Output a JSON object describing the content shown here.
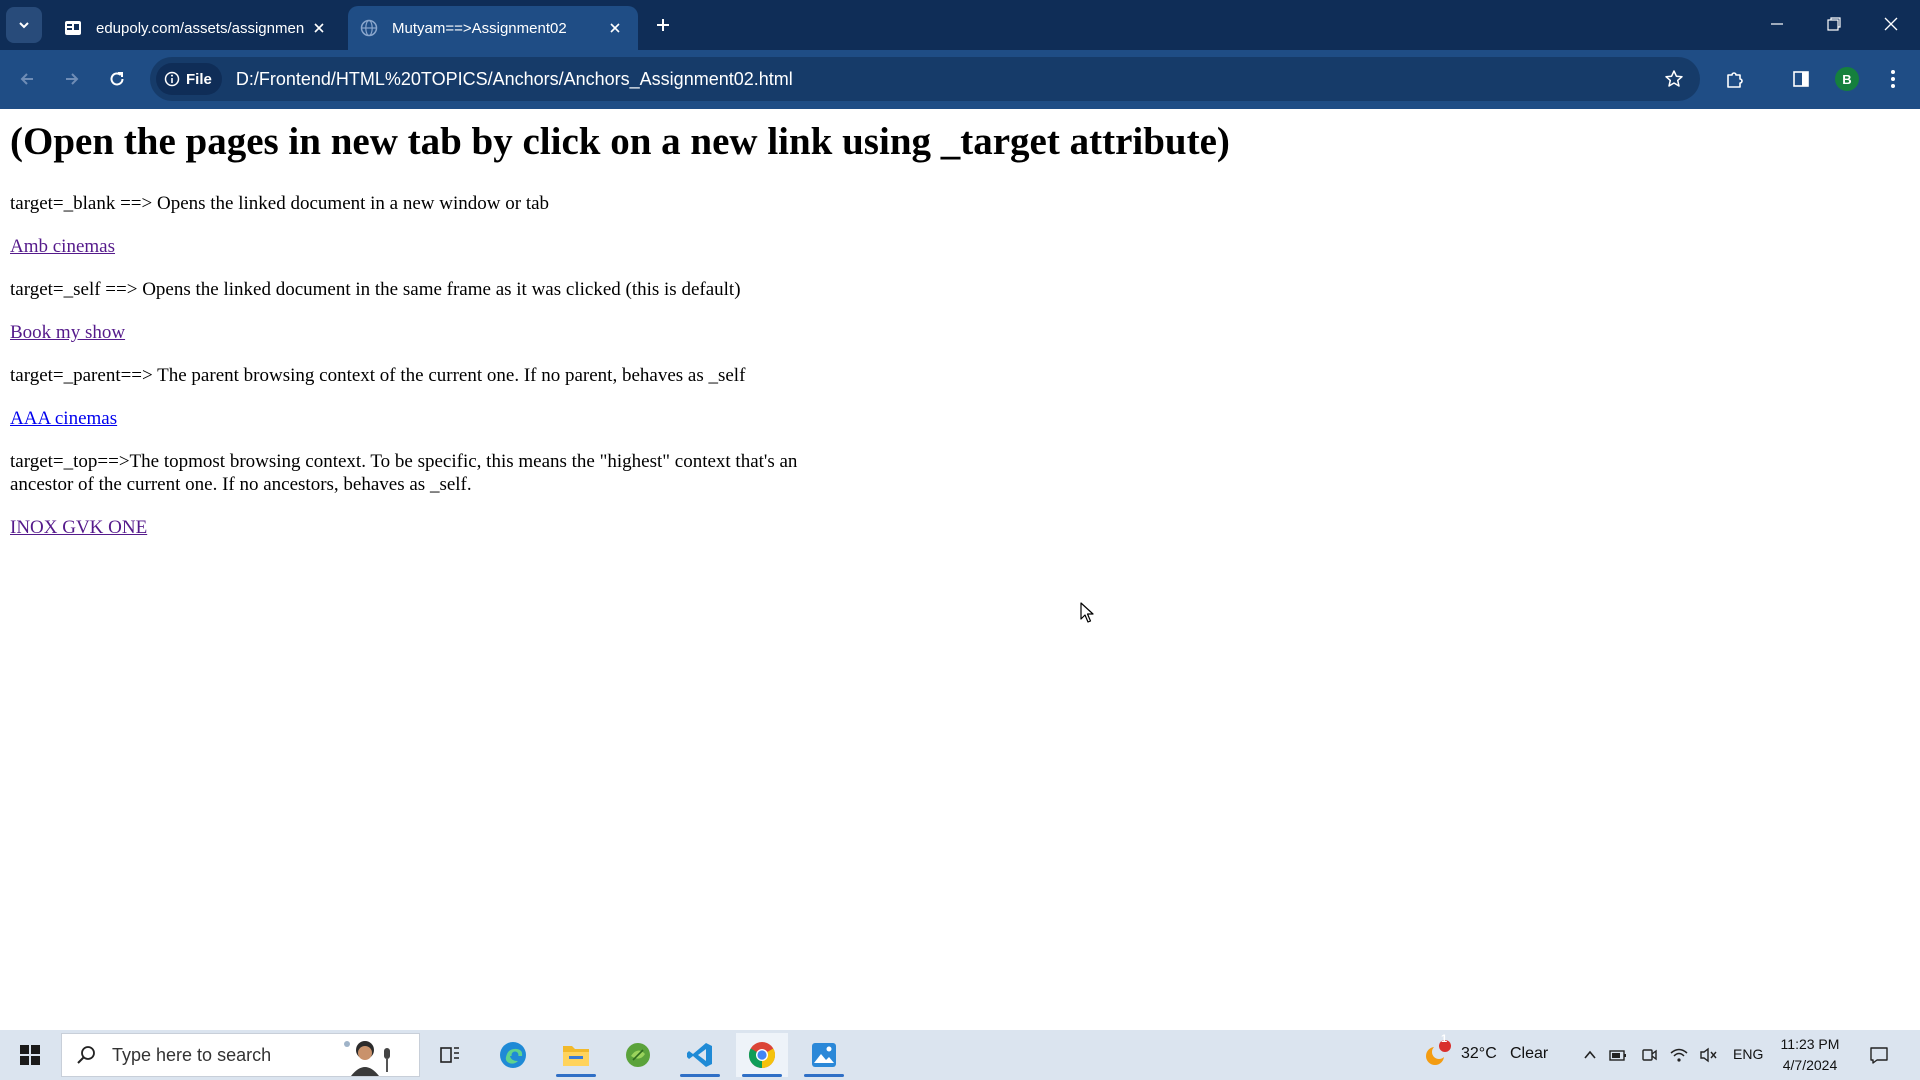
{
  "browser": {
    "tabs": [
      {
        "title": "edupoly.com/assets/assignmen",
        "active": false,
        "favicon": "edupoly-favicon-icon"
      },
      {
        "title": "Mutyam==>Assignment02",
        "active": true,
        "favicon": "globe-icon"
      }
    ],
    "address": {
      "chip_label": "File",
      "url": "D:/Frontend/HTML%20TOPICS/Anchors/Anchors_Assignment02.html"
    },
    "profile_initial": "B",
    "colors": {
      "tabstrip": "#0f2d57",
      "toolbar": "#1f4d85"
    }
  },
  "page": {
    "heading": "(Open the pages in new tab by click on a new link using _target attribute)",
    "sections": [
      {
        "desc": "target=_blank ==> Opens the linked document in a new window or tab",
        "link": "Amb cinemas",
        "visited": true
      },
      {
        "desc": "target=_self ==> Opens the linked document in the same frame as it was clicked (this is default)",
        "link": "Book my show",
        "visited": true
      },
      {
        "desc": "target=_parent==> The parent browsing context of the current one. If no parent, behaves as _self",
        "link": "AAA cinemas",
        "visited": false
      },
      {
        "desc": "target=_top==>The topmost browsing context. To be specific, this means the \"highest\" context that's an ancestor of the current one. If no ancestors, behaves as _self.",
        "link": "INOX GVK ONE",
        "visited": true
      }
    ],
    "colors": {
      "visited_link": "#551a8b",
      "unvisited_link": "#0000ee"
    }
  },
  "taskbar": {
    "search_placeholder": "Type here to search",
    "apps": [
      "task-view-icon",
      "edge-icon",
      "file-explorer-icon",
      "green-app-icon",
      "vscode-icon",
      "chrome-icon",
      "photos-icon"
    ],
    "weather": {
      "temp": "32°C",
      "condition": "Clear",
      "badge": "1"
    },
    "language": "ENG",
    "time": "11:23 PM",
    "date": "4/7/2024"
  }
}
